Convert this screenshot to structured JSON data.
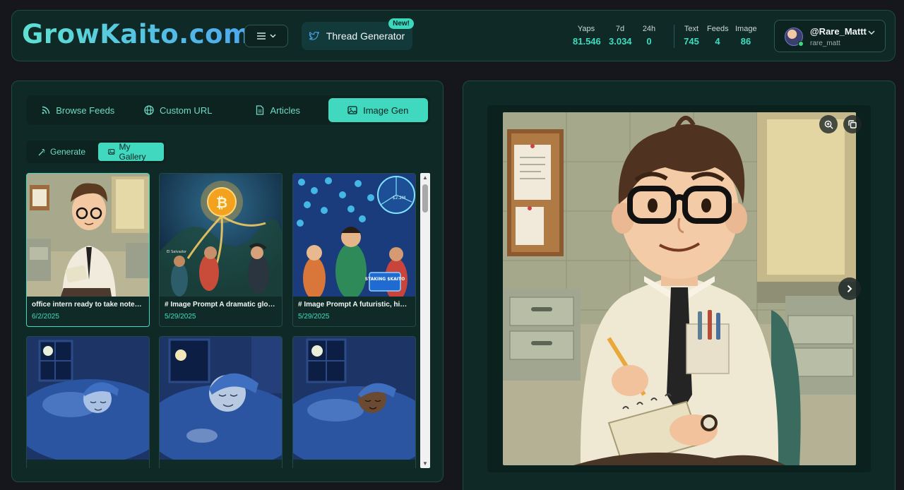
{
  "header": {
    "logo": "GrowKaito.com",
    "thread_button": "Thread Generator",
    "new_badge": "New!",
    "stats_left": [
      {
        "label": "Yaps",
        "value": "81.546"
      },
      {
        "label": "7d",
        "value": "3.034"
      },
      {
        "label": "24h",
        "value": "0"
      }
    ],
    "stats_right": [
      {
        "label": "Text",
        "value": "745"
      },
      {
        "label": "Feeds",
        "value": "4"
      },
      {
        "label": "Image",
        "value": "86"
      }
    ],
    "user": {
      "name": "@Rare_Mattt",
      "handle": "rare_matt"
    }
  },
  "tabs": [
    {
      "label": "Browse Feeds",
      "icon": "rss-icon"
    },
    {
      "label": "Custom URL",
      "icon": "globe-icon"
    },
    {
      "label": "Articles",
      "icon": "document-icon"
    },
    {
      "label": "Image Gen",
      "icon": "image-icon",
      "active": true
    }
  ],
  "subtabs": [
    {
      "label": "Generate",
      "icon": "wand-icon"
    },
    {
      "label": "My Gallery",
      "icon": "image-icon",
      "active": true
    }
  ],
  "gallery": [
    {
      "caption": "office intern ready to take notes, ...",
      "date": "6/2/2025",
      "scene": "office"
    },
    {
      "caption": "# Image Prompt A dramatic globa...",
      "date": "5/29/2025",
      "scene": "bitcoin"
    },
    {
      "caption": "# Image Prompt A futuristic, high-...",
      "date": "5/29/2025",
      "scene": "staking"
    },
    {
      "caption": "",
      "date": "",
      "scene": "sleep"
    },
    {
      "caption": "",
      "date": "",
      "scene": "sleep"
    },
    {
      "caption": "",
      "date": "",
      "scene": "sleep"
    }
  ],
  "thumb_text": {
    "region": "El Salvador",
    "staking": "STAKING $KAITO",
    "stat": "$2.2M"
  },
  "colors": {
    "accent": "#41d8c0",
    "panel": "#0f2a26",
    "background": "#15171c"
  }
}
